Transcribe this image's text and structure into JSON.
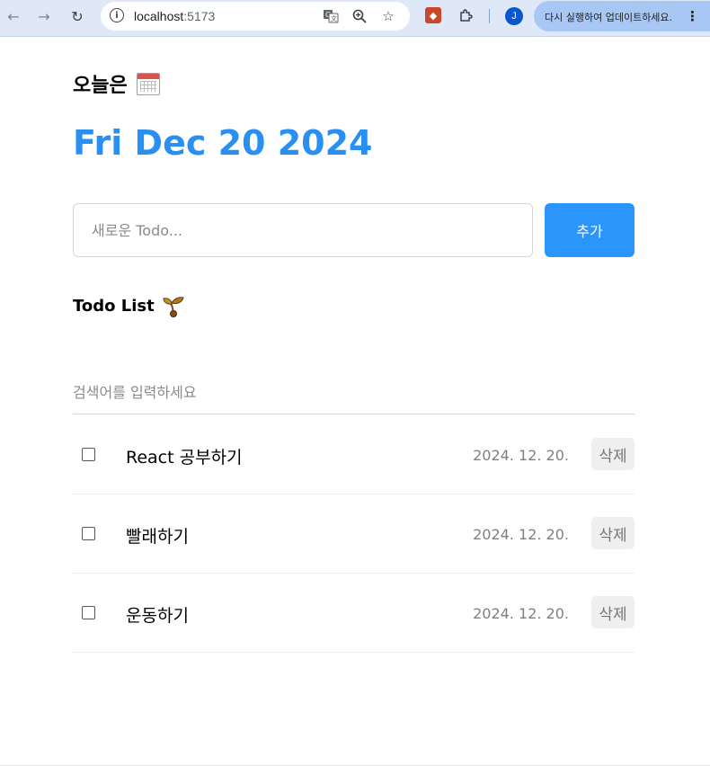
{
  "browser": {
    "url_host": "localhost",
    "url_port": ":5173",
    "update_text": "다시 실행하여 업데이트하세요.",
    "avatar_letter": "J"
  },
  "header": {
    "today_label": "오늘은",
    "date_title": "Fri Dec 20 2024"
  },
  "editor": {
    "placeholder": "새로운 Todo...",
    "add_label": "추가"
  },
  "list": {
    "title": "Todo List",
    "search_placeholder": "검색어를 입력하세요",
    "items": [
      {
        "content": "React 공부하기",
        "date": "2024. 12. 20.",
        "done": false,
        "delete_label": "삭제"
      },
      {
        "content": "빨래하기",
        "date": "2024. 12. 20.",
        "done": false,
        "delete_label": "삭제"
      },
      {
        "content": "운동하기",
        "date": "2024. 12. 20.",
        "done": false,
        "delete_label": "삭제"
      }
    ]
  },
  "colors": {
    "accent": "#2a95fb",
    "date_title": "#2a8ff2"
  },
  "icons": {
    "calendar": "calendar-icon",
    "sprout": "sprout-icon"
  }
}
